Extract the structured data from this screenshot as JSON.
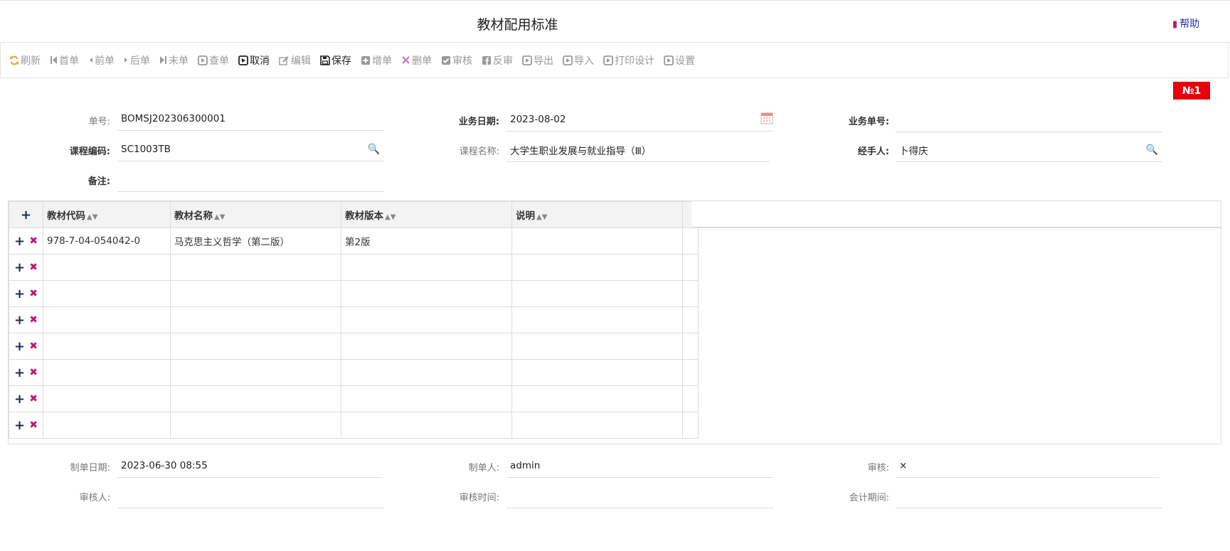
{
  "header": {
    "title": "教材配用标准",
    "help_label": "帮助"
  },
  "toolbar": {
    "buttons": [
      {
        "key": "refresh",
        "label": "刷新",
        "icon": "refresh-icon",
        "active": false
      },
      {
        "key": "first",
        "label": "首单",
        "icon": "first-icon",
        "active": false
      },
      {
        "key": "prev",
        "label": "前单",
        "icon": "prev-icon",
        "active": false
      },
      {
        "key": "next",
        "label": "后单",
        "icon": "next-icon",
        "active": false
      },
      {
        "key": "last",
        "label": "末单",
        "icon": "last-icon",
        "active": false
      },
      {
        "key": "query",
        "label": "查单",
        "icon": "play-square-icon",
        "active": false
      },
      {
        "key": "cancel",
        "label": "取消",
        "icon": "play-square-icon",
        "active": true
      },
      {
        "key": "edit",
        "label": "编辑",
        "icon": "edit-icon",
        "active": false
      },
      {
        "key": "save",
        "label": "保存",
        "icon": "save-icon",
        "active": true
      },
      {
        "key": "add",
        "label": "增单",
        "icon": "plus-square-icon",
        "active": false
      },
      {
        "key": "delete",
        "label": "删单",
        "icon": "times-icon",
        "active": false
      },
      {
        "key": "audit",
        "label": "审核",
        "icon": "check-square-icon",
        "active": false
      },
      {
        "key": "unaudit",
        "label": "反审",
        "icon": "facebook-square-icon",
        "active": false
      },
      {
        "key": "export",
        "label": "导出",
        "icon": "play-square-icon",
        "active": false
      },
      {
        "key": "import",
        "label": "导入",
        "icon": "play-square-icon",
        "active": false
      },
      {
        "key": "print_design",
        "label": "打印设计",
        "icon": "play-square-icon",
        "active": false
      },
      {
        "key": "settings",
        "label": "设置",
        "icon": "play-square-icon",
        "active": false
      }
    ]
  },
  "badge": {
    "number_label": "№1"
  },
  "form": {
    "order_no_label": "单号:",
    "order_no_value": "BOMSJ202306300001",
    "biz_date_label": "业务日期:",
    "biz_date_value": "2023-08-02",
    "biz_no_label": "业务单号:",
    "biz_no_value": "",
    "course_code_label": "课程编码:",
    "course_code_value": "SC1003TB",
    "course_name_label": "课程名称:",
    "course_name_value": "大学生职业发展与就业指导（Ⅲ）",
    "handler_label": "经手人:",
    "handler_value": "卜得庆",
    "remark_label": "备注:",
    "remark_value": ""
  },
  "grid": {
    "columns": [
      "教材代码",
      "教材名称",
      "教材版本",
      "说明"
    ],
    "rows": [
      [
        "978-7-04-054042-0",
        "马克思主义哲学（第二版）",
        "第2版",
        ""
      ],
      [
        "",
        "",
        "",
        ""
      ],
      [
        "",
        "",
        "",
        ""
      ],
      [
        "",
        "",
        "",
        ""
      ],
      [
        "",
        "",
        "",
        ""
      ],
      [
        "",
        "",
        "",
        ""
      ],
      [
        "",
        "",
        "",
        ""
      ],
      [
        "",
        "",
        "",
        ""
      ]
    ]
  },
  "footer": {
    "made_date_label": "制单日期:",
    "made_date_value": "2023-06-30 08:55",
    "maker_label": "制单人:",
    "maker_value": "admin",
    "audit_label": "审核:",
    "audit_value": "×",
    "auditor_label": "审核人:",
    "auditor_value": "",
    "audit_time_label": "审核时间:",
    "audit_time_value": "",
    "period_label": "会计期间:",
    "period_value": ""
  }
}
